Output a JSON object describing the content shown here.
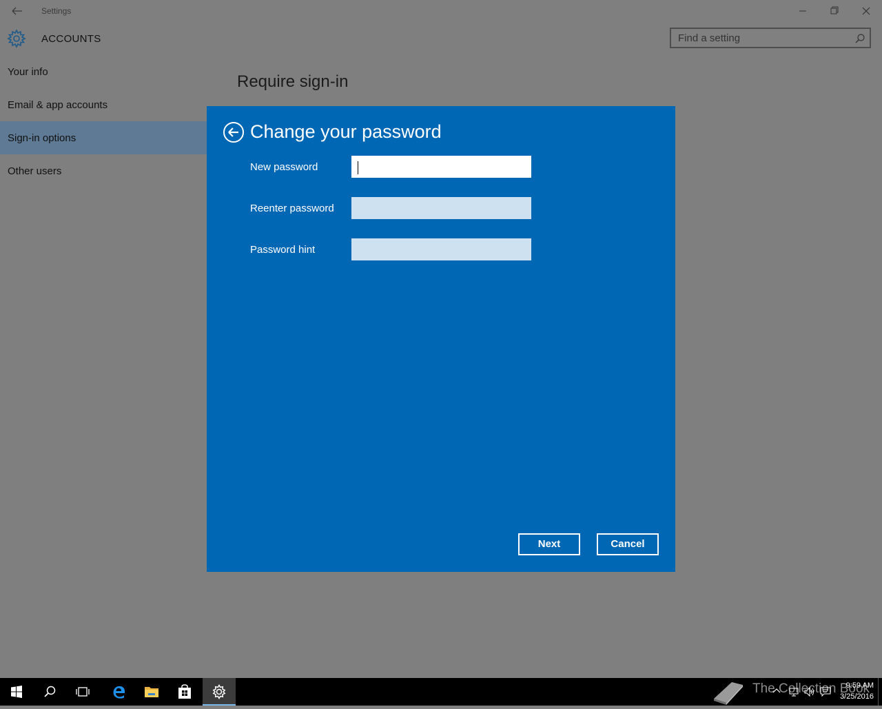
{
  "window": {
    "title": "Settings",
    "section_title": "ACCOUNTS",
    "search_placeholder": "Find a setting"
  },
  "sidebar": {
    "items": [
      {
        "label": "Your info",
        "selected": false
      },
      {
        "label": "Email & app accounts",
        "selected": false
      },
      {
        "label": "Sign-in options",
        "selected": true
      },
      {
        "label": "Other users",
        "selected": false
      }
    ]
  },
  "content": {
    "title": "Require sign-in"
  },
  "dialog": {
    "title": "Change your password",
    "fields": [
      {
        "label": "New password",
        "value": "",
        "focused": true
      },
      {
        "label": "Reenter password",
        "value": "",
        "focused": false
      },
      {
        "label": "Password hint",
        "value": "",
        "focused": false
      }
    ],
    "next_label": "Next",
    "cancel_label": "Cancel",
    "accent_color": "#0067b5"
  },
  "taskbar": {
    "apps": [
      "start-icon",
      "search-icon",
      "task-view-icon",
      "edge-icon",
      "file-explorer-icon",
      "store-icon",
      "settings-icon"
    ],
    "active_app": "settings-icon",
    "watermark": "The Collection Book",
    "time": "9:59 AM",
    "date": "3/25/2016"
  }
}
